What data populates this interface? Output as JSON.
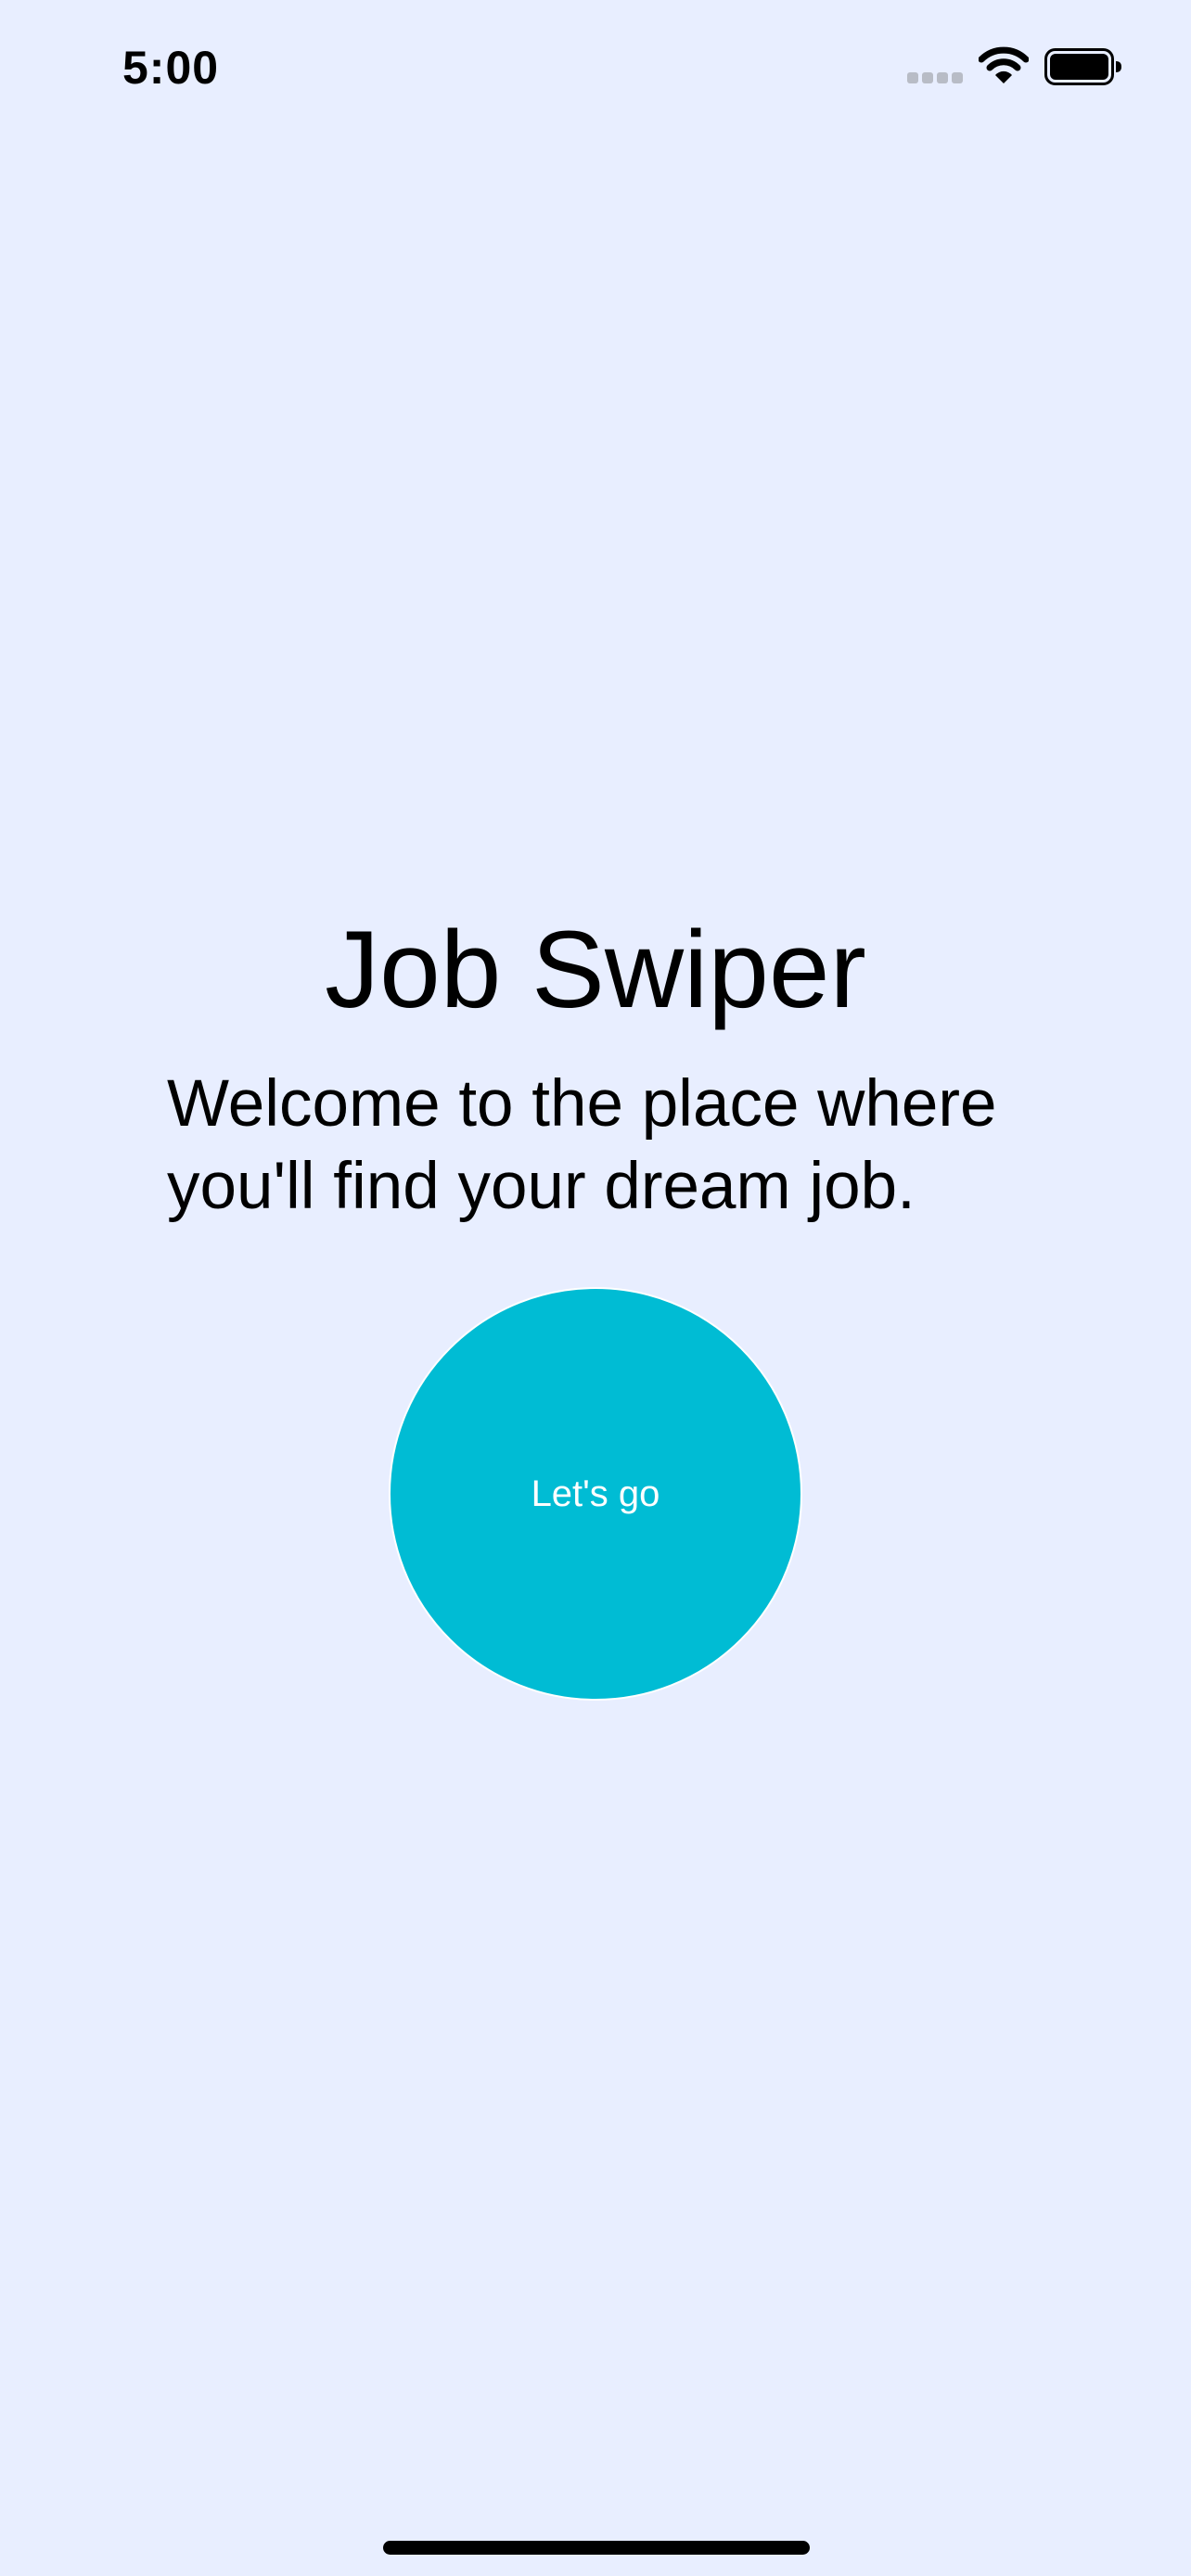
{
  "status_bar": {
    "time": "5:00",
    "icons": [
      "signal-icon",
      "wifi-icon",
      "battery-icon"
    ]
  },
  "main": {
    "title": "Job Swiper",
    "subtitle": "Welcome to the place where you'll find your dream job.",
    "cta_label": "Let's go"
  },
  "colors": {
    "background": "#e8eeff",
    "accent": "#00bcd4",
    "text": "#000000",
    "button_text": "#ffffff"
  }
}
